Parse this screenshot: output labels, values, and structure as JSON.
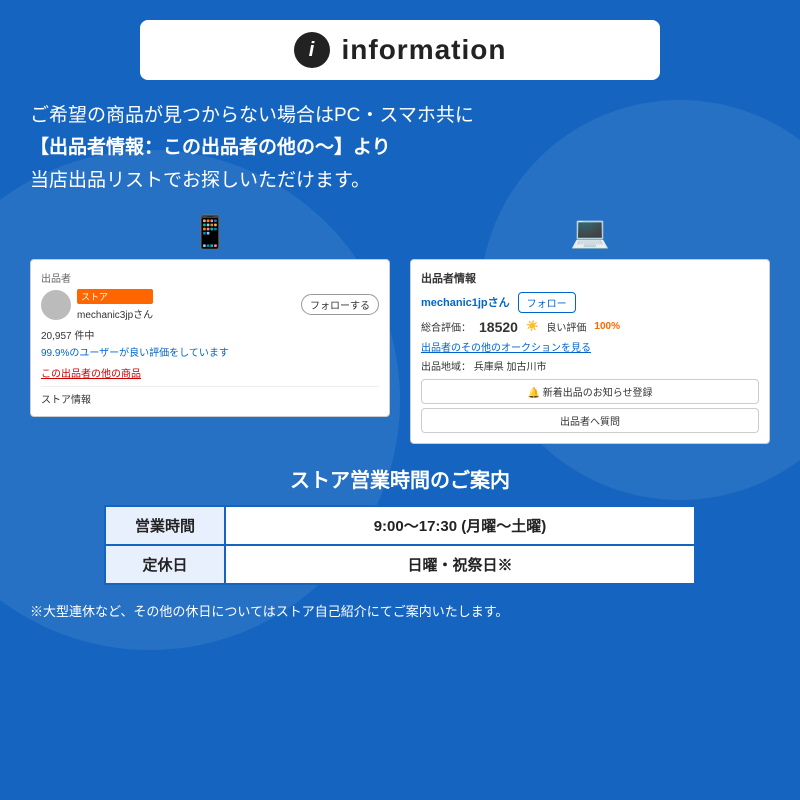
{
  "header": {
    "icon_label": "i",
    "title": "information"
  },
  "main_text": {
    "line1": "ご希望の商品が見つからない場合はPC・スマホ共に",
    "line2": "【出品者情報：この出品者の他の〜】より",
    "line3": "当店出品リストでお探しいただけます。"
  },
  "left_panel": {
    "section_label": "出品者",
    "store_badge": "ストア",
    "seller_name": "mechanic3jpさん",
    "follow_btn": "フォローする",
    "review_count": "20,957 件中",
    "review_percent": "99.9%のユーザーが良い評価をしています",
    "other_items_link": "この出品者の他の商品",
    "store_info": "ストア情報"
  },
  "right_panel": {
    "section_label": "出品者情報",
    "seller_name": "mechanic1jpさん",
    "follow_btn": "フォロー",
    "rating_label": "総合評価：",
    "rating_num": "18520",
    "good_label": "良い評価",
    "good_percent": "100%",
    "auction_link": "出品者のその他のオークションを見る",
    "location_label": "出品地域：",
    "location": "兵庫県 加古川市",
    "notify_btn": "🔔 新着出品のお知らせ登録",
    "question_btn": "出品者へ質問"
  },
  "hours_section": {
    "title": "ストア営業時間のご案内",
    "row1_label": "営業時間",
    "row1_value": "9:00〜17:30 (月曜〜土曜)",
    "row2_label": "定休日",
    "row2_value": "日曜・祝祭日※"
  },
  "footer_note": "※大型連休など、その他の休日についてはストア自己紹介にてご案内いたします。"
}
